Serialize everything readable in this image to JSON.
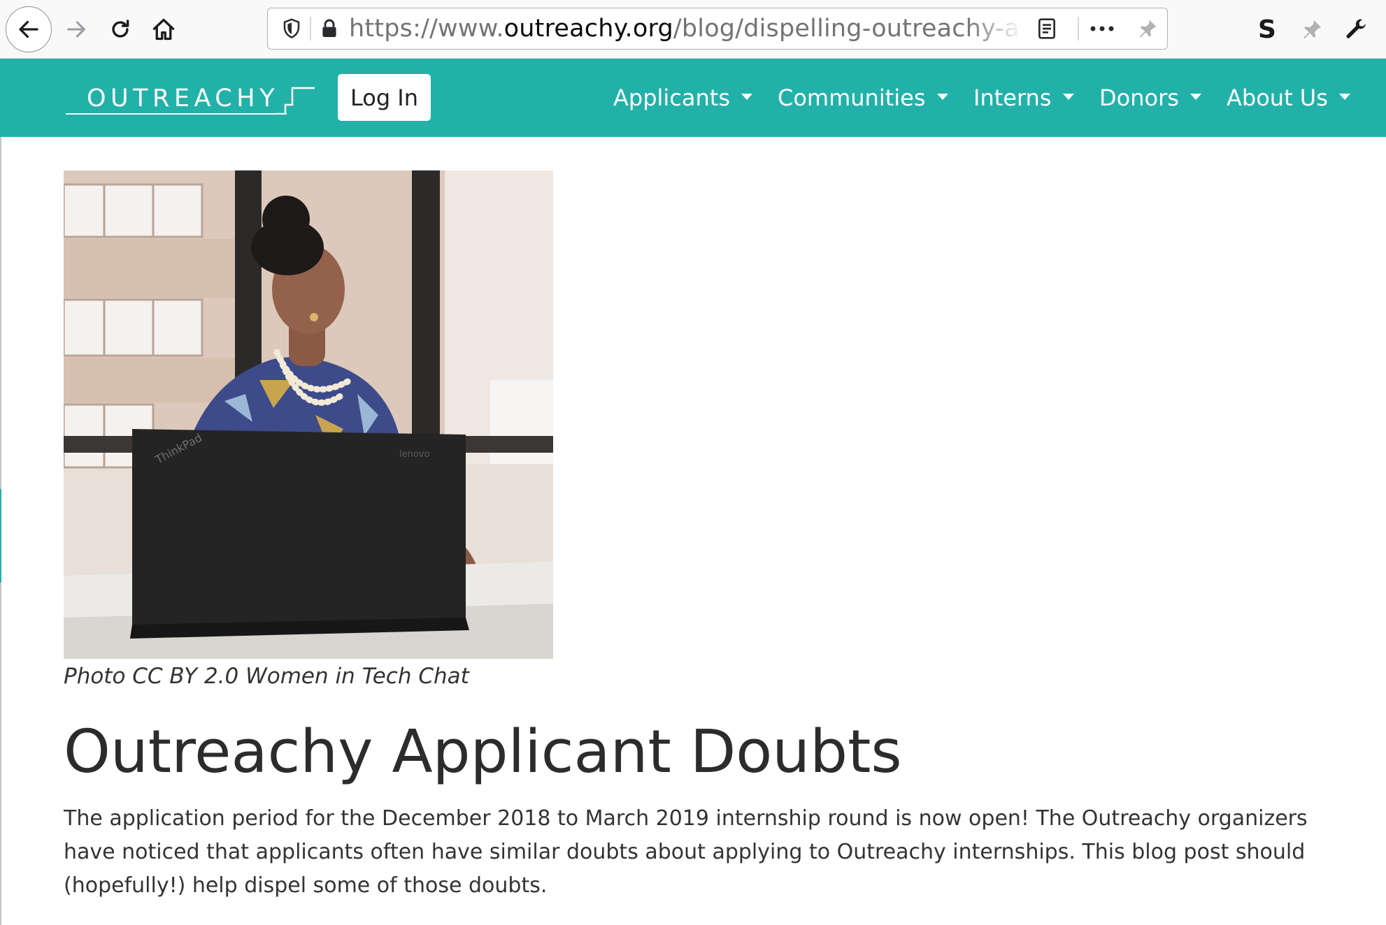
{
  "browser": {
    "url_prefix": "https://www.",
    "url_domain": "outreachy.org",
    "url_path": "/blog/dispelling-outreachy-appli",
    "extension_s_label": "S",
    "icons": [
      "back-arrow-icon",
      "forward-arrow-icon",
      "reload-icon",
      "home-icon",
      "shield-icon",
      "lock-icon",
      "reader-view-icon",
      "more-icon",
      "pin-icon",
      "extension-s-icon",
      "extension-pin-icon",
      "wrench-icon"
    ]
  },
  "navbar": {
    "brand": "OUTREACHY",
    "login_label": "Log In",
    "items": [
      {
        "label": "Applicants"
      },
      {
        "label": "Communities"
      },
      {
        "label": "Interns"
      },
      {
        "label": "Donors"
      },
      {
        "label": "About Us"
      }
    ],
    "background_color": "#22b1a8"
  },
  "article": {
    "caption": "Photo CC BY 2.0 Women in Tech Chat",
    "title": "Outreachy Applicant Doubts",
    "body": "The application period for the December 2018 to March 2019 internship round is now open! The Outreachy organizers have noticed that applicants often have similar doubts about applying to Outreachy internships. This blog post should (hopefully!) help dispel some of those doubts."
  }
}
